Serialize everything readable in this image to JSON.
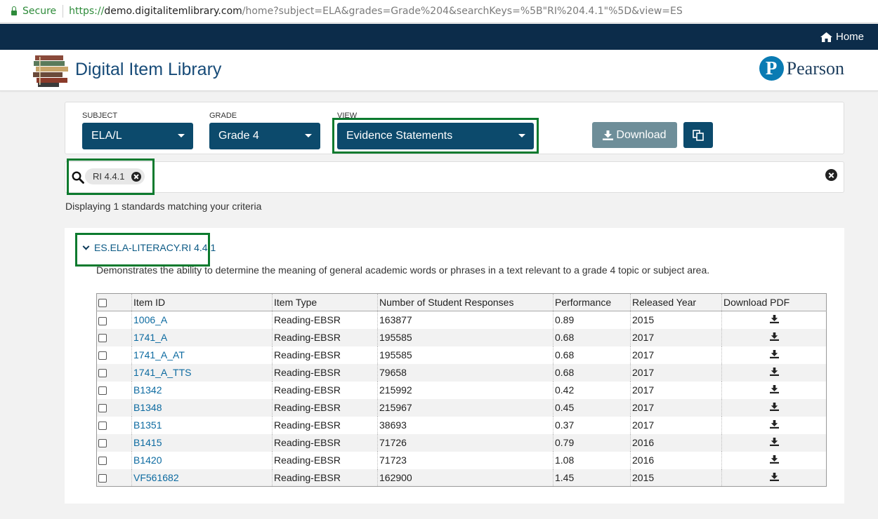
{
  "browser": {
    "secure_label": "Secure",
    "url_scheme": "https://",
    "url_host": "demo.digitalitemlibrary.com",
    "url_path": "/home?subject=ELA&grades=Grade%204&searchKeys=%5B\"RI%204.4.1\"%5D&view=ES"
  },
  "topbar": {
    "home_label": "Home"
  },
  "header": {
    "app_title": "Digital Item Library",
    "brand_initial": "P",
    "brand_name": "Pearson"
  },
  "filters": {
    "subject": {
      "label": "SUBJECT",
      "value": "ELA/L"
    },
    "grade": {
      "label": "GRADE",
      "value": "Grade 4"
    },
    "view": {
      "label": "VIEW",
      "value": "Evidence Statements"
    },
    "download_label": "Download"
  },
  "search": {
    "chip": "RI 4.4.1"
  },
  "results": {
    "count_text": "Displaying 1 standards matching your criteria",
    "standard_code": "ES.ELA-LITERACY.RI 4.4.1",
    "standard_description": "Demonstrates the ability to determine the meaning of general academic words or phrases in a text relevant to a grade 4 topic or subject area.",
    "columns": [
      "Item ID",
      "Item Type",
      "Number of Student Responses",
      "Performance",
      "Released Year",
      "Download PDF"
    ],
    "rows": [
      {
        "id": "1006_A",
        "type": "Reading-EBSR",
        "responses": "163877",
        "performance": "0.89",
        "year": "2015"
      },
      {
        "id": "1741_A",
        "type": "Reading-EBSR",
        "responses": "195585",
        "performance": "0.68",
        "year": "2017"
      },
      {
        "id": "1741_A_AT",
        "type": "Reading-EBSR",
        "responses": "195585",
        "performance": "0.68",
        "year": "2017"
      },
      {
        "id": "1741_A_TTS",
        "type": "Reading-EBSR",
        "responses": "79658",
        "performance": "0.68",
        "year": "2017"
      },
      {
        "id": "B1342",
        "type": "Reading-EBSR",
        "responses": "215992",
        "performance": "0.42",
        "year": "2017"
      },
      {
        "id": "B1348",
        "type": "Reading-EBSR",
        "responses": "215967",
        "performance": "0.45",
        "year": "2017"
      },
      {
        "id": "B1351",
        "type": "Reading-EBSR",
        "responses": "38693",
        "performance": "0.37",
        "year": "2017"
      },
      {
        "id": "B1415",
        "type": "Reading-EBSR",
        "responses": "71726",
        "performance": "0.79",
        "year": "2016"
      },
      {
        "id": "B1420",
        "type": "Reading-EBSR",
        "responses": "71723",
        "performance": "1.08",
        "year": "2016"
      },
      {
        "id": "VF561682",
        "type": "Reading-EBSR",
        "responses": "162900",
        "performance": "1.45",
        "year": "2015"
      }
    ]
  },
  "colors": {
    "navy": "#0c2c4a",
    "select": "#0c4a6c",
    "highlight": "#0c7a2e",
    "link": "#0c6aa0"
  }
}
